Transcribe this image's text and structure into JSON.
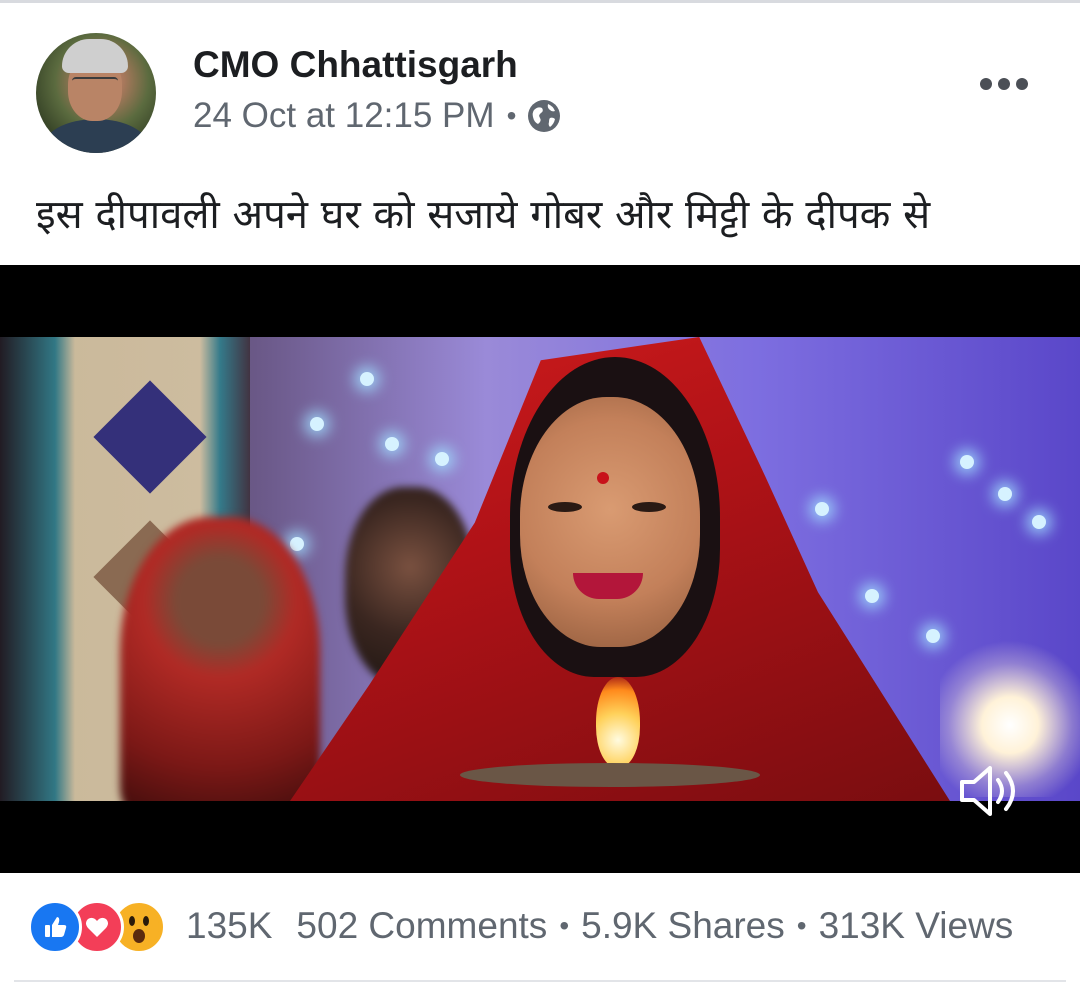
{
  "post": {
    "page_name": "CMO Chhattisgarh",
    "date": "24 Oct at 12:15 PM",
    "separator": "•",
    "privacy_icon": "globe-icon",
    "more_icon": "more-options-icon",
    "text": "इस दीपावली अपने घर को सजाये गोबर और मिट्टी के दीपक से"
  },
  "video": {
    "sound_icon": "volume-icon"
  },
  "footer": {
    "reaction_icons": [
      "like-icon",
      "love-icon",
      "wow-icon"
    ],
    "reaction_count": "135K",
    "comments": "502 Comments",
    "shares": "5.9K Shares",
    "views": "313K Views",
    "separator": "•"
  },
  "colors": {
    "like": "#1877f2",
    "love": "#f33e58",
    "wow": "#f7b125",
    "secondary_text": "#606770"
  }
}
